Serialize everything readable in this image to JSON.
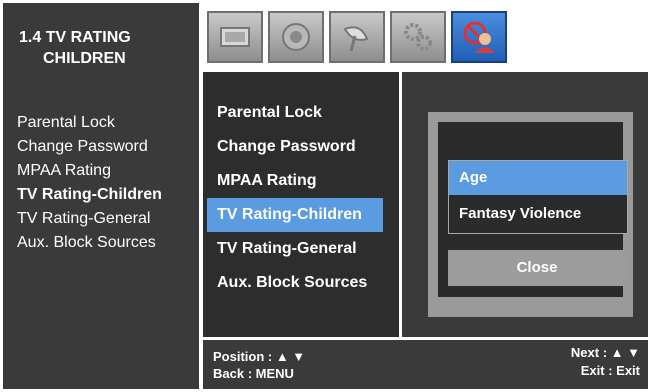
{
  "header": {
    "title_line1": "1.4 TV RATING",
    "title_line2": "CHILDREN"
  },
  "sidebar": {
    "items": [
      {
        "label": "Parental Lock"
      },
      {
        "label": "Change Password"
      },
      {
        "label": "MPAA Rating"
      },
      {
        "label": "TV Rating-Children",
        "active": true
      },
      {
        "label": "TV Rating-General"
      },
      {
        "label": "Aux. Block Sources"
      }
    ]
  },
  "tabs": [
    {
      "icon": "picture-icon"
    },
    {
      "icon": "sound-icon"
    },
    {
      "icon": "satellite-dish-icon"
    },
    {
      "icon": "settings-gears-icon"
    },
    {
      "icon": "parental-control-icon",
      "selected": true
    }
  ],
  "menu": {
    "items": [
      {
        "label": "Parental Lock"
      },
      {
        "label": "Change Password"
      },
      {
        "label": "MPAA Rating"
      },
      {
        "label": "TV Rating-Children",
        "highlighted": true
      },
      {
        "label": "TV Rating-General"
      },
      {
        "label": "Aux. Block Sources"
      }
    ]
  },
  "dialog": {
    "options": [
      {
        "label": "Age",
        "selected": true
      },
      {
        "label": "Fantasy Violence"
      }
    ],
    "close_label": "Close"
  },
  "footer": {
    "position_label": "Position : ▲ ▼",
    "back_label": "Back : MENU",
    "next_label": "Next : ▲ ▼",
    "exit_label": "Exit : Exit"
  },
  "colors": {
    "highlight": "#5b9be0",
    "selected_tab": "#2a6fcb",
    "panel": "#3a3a3a"
  }
}
